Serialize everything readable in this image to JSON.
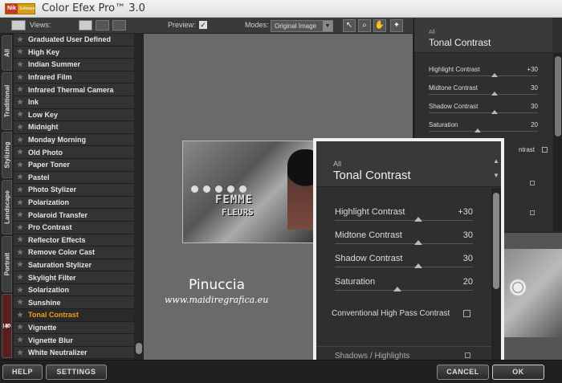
{
  "app": {
    "title": "Color Efex Pro™ 3.0",
    "logo_text": "Nik",
    "logo_sub": "Software"
  },
  "toolbar": {
    "views_label": "Views:",
    "preview_label": "Preview:",
    "preview_checked": true,
    "modes_label": "Modes:",
    "modes_value": "Original Image",
    "tools": [
      "pointer-icon",
      "zoom-icon",
      "hand-icon",
      "loupe-icon"
    ]
  },
  "tabs": [
    "All",
    "Traditional",
    "Stylizing",
    "Landscape",
    "Portrait",
    "Favorites"
  ],
  "filters": [
    "Graduated User Defined",
    "High Key",
    "Indian Summer",
    "Infrared Film",
    "Infrared Thermal Camera",
    "Ink",
    "Low Key",
    "Midnight",
    "Monday Morning",
    "Old Photo",
    "Paper Toner",
    "Pastel",
    "Photo Stylizer",
    "Polarization",
    "Polaroid Transfer",
    "Pro Contrast",
    "Reflector Effects",
    "Remove Color Cast",
    "Saturation Stylizer",
    "Skylight Filter",
    "Solarization",
    "Sunshine",
    "Tonal Contrast",
    "Vignette",
    "Vignette Blur",
    "White Neutralizer"
  ],
  "selected_filter": "Tonal Contrast",
  "preview_image": {
    "title_line1": "FEMME",
    "title_line2": "FLEURS"
  },
  "watermark": {
    "name": "Pinuccia",
    "url": "www.maidiregrafica.eu"
  },
  "panel": {
    "category": "All",
    "filter_name": "Tonal Contrast",
    "sliders": [
      {
        "label": "Highlight Contrast",
        "value": "+30",
        "level": 0.6
      },
      {
        "label": "Midtone Contrast",
        "value": "30",
        "level": 0.6
      },
      {
        "label": "Shadow Contrast",
        "value": "30",
        "level": 0.6
      },
      {
        "label": "Saturation",
        "value": "20",
        "level": 0.45
      }
    ],
    "checkbox_label": "Conventional High Pass Contrast",
    "checkbox_short": "ntrast",
    "checkbox_checked": false,
    "section_label": "Shadows / Highlights"
  },
  "buttons": {
    "help": "HELP",
    "settings": "SETTINGS",
    "cancel": "CANCEL",
    "ok": "OK"
  }
}
